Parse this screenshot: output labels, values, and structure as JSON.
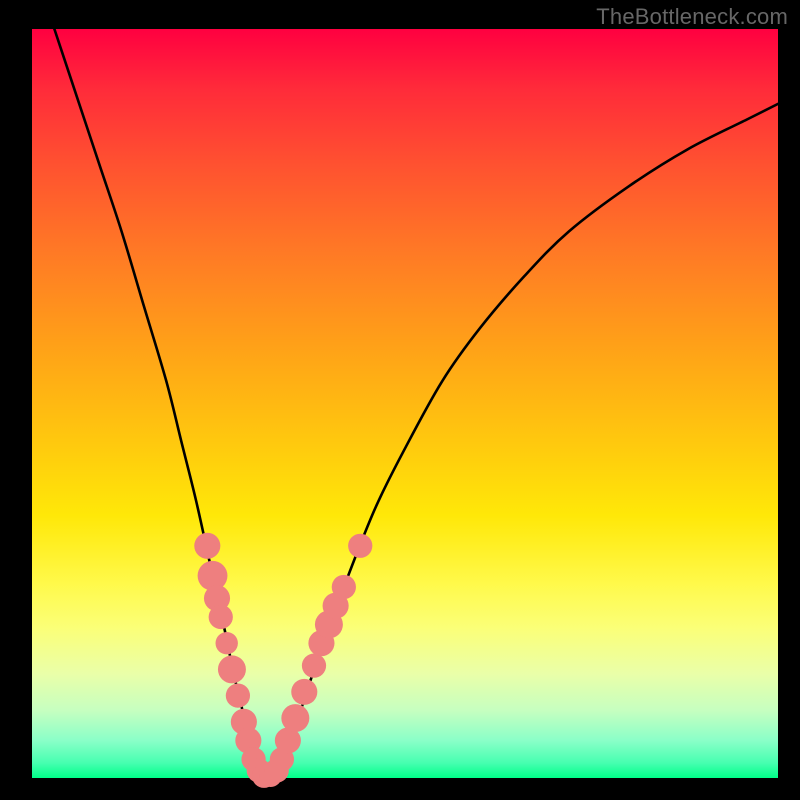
{
  "watermark": "TheBottleneck.com",
  "chart_data": {
    "type": "line",
    "title": "",
    "xlabel": "",
    "ylabel": "",
    "xlim": [
      0,
      100
    ],
    "ylim": [
      0,
      100
    ],
    "grid": false,
    "legend": false,
    "series": [
      {
        "name": "bottleneck-curve",
        "color": "#000000",
        "x": [
          3,
          6,
          9,
          12,
          15,
          18,
          20,
          22,
          24,
          26,
          27,
          28,
          29,
          30,
          31,
          32,
          33,
          35,
          38,
          42,
          46,
          50,
          55,
          60,
          66,
          72,
          80,
          88,
          96,
          100
        ],
        "y": [
          100,
          91,
          82,
          73,
          63,
          53,
          45,
          37,
          28,
          19,
          14,
          10,
          5,
          1,
          0,
          0,
          1,
          6,
          15,
          26,
          36,
          44,
          53,
          60,
          67,
          73,
          79,
          84,
          88,
          90
        ]
      },
      {
        "name": "marker-dots",
        "color": "#ee7f7f",
        "type": "scatter",
        "points": [
          {
            "x": 23.5,
            "y": 31,
            "r": 1.4
          },
          {
            "x": 24.2,
            "y": 27,
            "r": 1.6
          },
          {
            "x": 24.8,
            "y": 24,
            "r": 1.4
          },
          {
            "x": 25.3,
            "y": 21.5,
            "r": 1.3
          },
          {
            "x": 26.1,
            "y": 18,
            "r": 1.2
          },
          {
            "x": 26.8,
            "y": 14.5,
            "r": 1.5
          },
          {
            "x": 27.6,
            "y": 11,
            "r": 1.3
          },
          {
            "x": 28.4,
            "y": 7.5,
            "r": 1.4
          },
          {
            "x": 29.0,
            "y": 5,
            "r": 1.4
          },
          {
            "x": 29.7,
            "y": 2.5,
            "r": 1.3
          },
          {
            "x": 30.4,
            "y": 1,
            "r": 1.3
          },
          {
            "x": 31.1,
            "y": 0.3,
            "r": 1.3
          },
          {
            "x": 32.0,
            "y": 0.3,
            "r": 1.2
          },
          {
            "x": 32.8,
            "y": 1,
            "r": 1.3
          },
          {
            "x": 33.5,
            "y": 2.5,
            "r": 1.3
          },
          {
            "x": 34.3,
            "y": 5,
            "r": 1.4
          },
          {
            "x": 35.3,
            "y": 8,
            "r": 1.5
          },
          {
            "x": 36.5,
            "y": 11.5,
            "r": 1.4
          },
          {
            "x": 37.8,
            "y": 15,
            "r": 1.3
          },
          {
            "x": 38.8,
            "y": 18,
            "r": 1.4
          },
          {
            "x": 39.8,
            "y": 20.5,
            "r": 1.5
          },
          {
            "x": 40.7,
            "y": 23,
            "r": 1.4
          },
          {
            "x": 41.8,
            "y": 25.5,
            "r": 1.3
          },
          {
            "x": 44.0,
            "y": 31,
            "r": 1.3
          }
        ]
      }
    ]
  }
}
